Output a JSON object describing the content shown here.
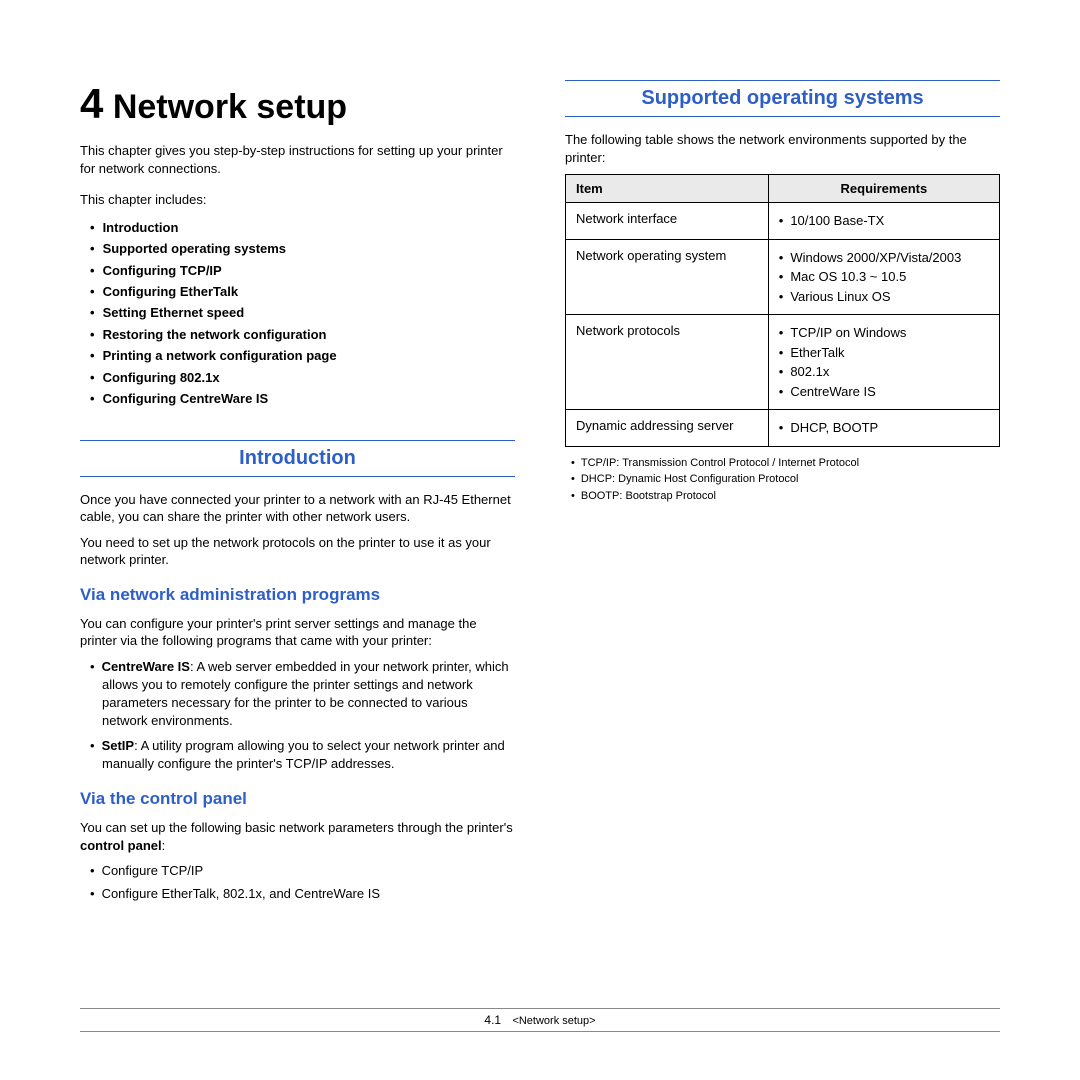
{
  "chapter": {
    "number": "4",
    "title": "Network setup"
  },
  "left": {
    "p1": "This chapter gives you step-by-step instructions for setting up your printer for network connections.",
    "p2": "This chapter includes:",
    "toc": [
      "Introduction",
      "Supported operating systems",
      "Configuring TCP/IP",
      "Configuring EtherTalk",
      "Setting Ethernet speed",
      "Restoring the network configuration",
      "Printing a network configuration page",
      "Configuring 802.1x",
      "Configuring CentreWare IS"
    ],
    "intro": {
      "heading": "Introduction",
      "p1": "Once you have connected your printer to a network with an RJ-45 Ethernet cable, you can share the printer with other network users.",
      "p2": "You need to set up the network protocols on the printer to use it as your network printer."
    },
    "via_net": {
      "heading": "Via network administration programs",
      "p1": "You can configure your printer's print server settings and manage the printer via the following programs that came with your printer:",
      "items": [
        {
          "term": "CentreWare IS",
          "desc": ": A web server embedded in your network printer, which allows you to remotely configure the printer settings and network parameters necessary for the printer to be connected to various network environments."
        },
        {
          "term": "SetIP",
          "desc": ": A utility program allowing you to select your network printer and manually configure the printer's TCP/IP addresses."
        }
      ]
    },
    "via_cp": {
      "heading": "Via the control panel",
      "p1_pre": "You can set up the following basic network parameters through the printer's ",
      "p1_bold": "control panel",
      "p1_post": ":",
      "items": [
        "Configure TCP/IP",
        "Configure EtherTalk, 802.1x, and CentreWare IS"
      ]
    }
  },
  "right": {
    "heading": "Supported operating systems",
    "p1": "The following table shows the network environments supported by the printer:",
    "table": {
      "headers": [
        "Item",
        "Requirements"
      ],
      "rows": [
        {
          "item": "Network interface",
          "req": [
            "10/100 Base-TX"
          ]
        },
        {
          "item": "Network operating system",
          "req": [
            "Windows 2000/XP/Vista/2003",
            "Mac OS 10.3 ~ 10.5",
            "Various Linux OS"
          ]
        },
        {
          "item": "Network protocols",
          "req": [
            "TCP/IP on Windows",
            "EtherTalk",
            "802.1x",
            "CentreWare IS"
          ]
        },
        {
          "item": "Dynamic addressing server",
          "req": [
            "DHCP, BOOTP"
          ]
        }
      ]
    },
    "footnotes": [
      "TCP/IP: Transmission Control Protocol / Internet Protocol",
      "DHCP: Dynamic Host Configuration Protocol",
      "BOOTP: Bootstrap Protocol"
    ]
  },
  "footer": {
    "page_number": "4.1",
    "chapter_name": "<Network setup>"
  }
}
